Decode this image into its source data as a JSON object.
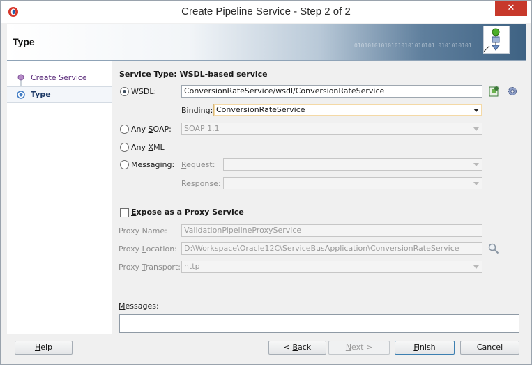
{
  "window": {
    "title": "Create Pipeline Service - Step 2 of 2",
    "close_glyph": "✕"
  },
  "banner": {
    "title": "Type",
    "binary_text": "010101010101010101010101 0101010101"
  },
  "nav": {
    "items": [
      {
        "label": "Create Service",
        "state": "visited"
      },
      {
        "label": "Type",
        "state": "current"
      }
    ]
  },
  "form": {
    "service_type_title": "Service Type: WSDL-based service",
    "wsdl": {
      "label_prefix": "",
      "label_u": "W",
      "label_rest": "SDL:",
      "value": "ConversionRateService/wsdl/ConversionRateService",
      "selected": true
    },
    "binding": {
      "label_u": "B",
      "label_rest": "inding:",
      "value": "ConversionRateService"
    },
    "any_soap": {
      "label_a": "Any ",
      "label_u": "S",
      "label_rest": "OAP:",
      "value": "SOAP 1.1",
      "selected": false
    },
    "any_xml": {
      "label_a": "Any ",
      "label_u": "X",
      "label_rest": "ML",
      "selected": false
    },
    "messaging": {
      "label_a": "Messa",
      "label_u": "g",
      "label_rest": "ing:",
      "selected": false
    },
    "request": {
      "label_u": "R",
      "label_rest": "equest:",
      "value": ""
    },
    "response": {
      "label_a": "Res",
      "label_u": "p",
      "label_rest": "onse:",
      "value": ""
    },
    "expose": {
      "label_u": "E",
      "label_rest": "xpose as a Proxy Service",
      "checked": false
    },
    "proxy_name": {
      "label": "Proxy Name:",
      "value": "ValidationPipelineProxyService"
    },
    "proxy_location": {
      "label_a": "Proxy ",
      "label_u": "L",
      "label_rest": "ocation:",
      "value": "D:\\Workspace\\Oracle12C\\ServiceBusApplication\\ConversionRateService"
    },
    "proxy_transport": {
      "label_a": "Proxy ",
      "label_u": "T",
      "label_rest": "ransport:",
      "value": "http"
    },
    "messages": {
      "label_u": "M",
      "label_rest": "essages:"
    }
  },
  "buttons": {
    "help": {
      "u": "H",
      "rest": "elp"
    },
    "back": {
      "pre": "< ",
      "u": "B",
      "rest": "ack"
    },
    "next": {
      "u": "N",
      "rest": "ext >"
    },
    "finish": {
      "u": "F",
      "rest": "inish"
    },
    "cancel": "Cancel"
  },
  "icons": {
    "app": "oracle-app-icon",
    "banner": "pipeline-service-icon",
    "wsdl_browse": "browse-wsdl-icon",
    "wsdl_settings": "gear-icon",
    "location_search": "magnifier-icon"
  },
  "colors": {
    "close": "#c7392b",
    "link": "#5a2a7a",
    "nav_current": "#1e3a66",
    "banner_dark": "#3e6283"
  }
}
